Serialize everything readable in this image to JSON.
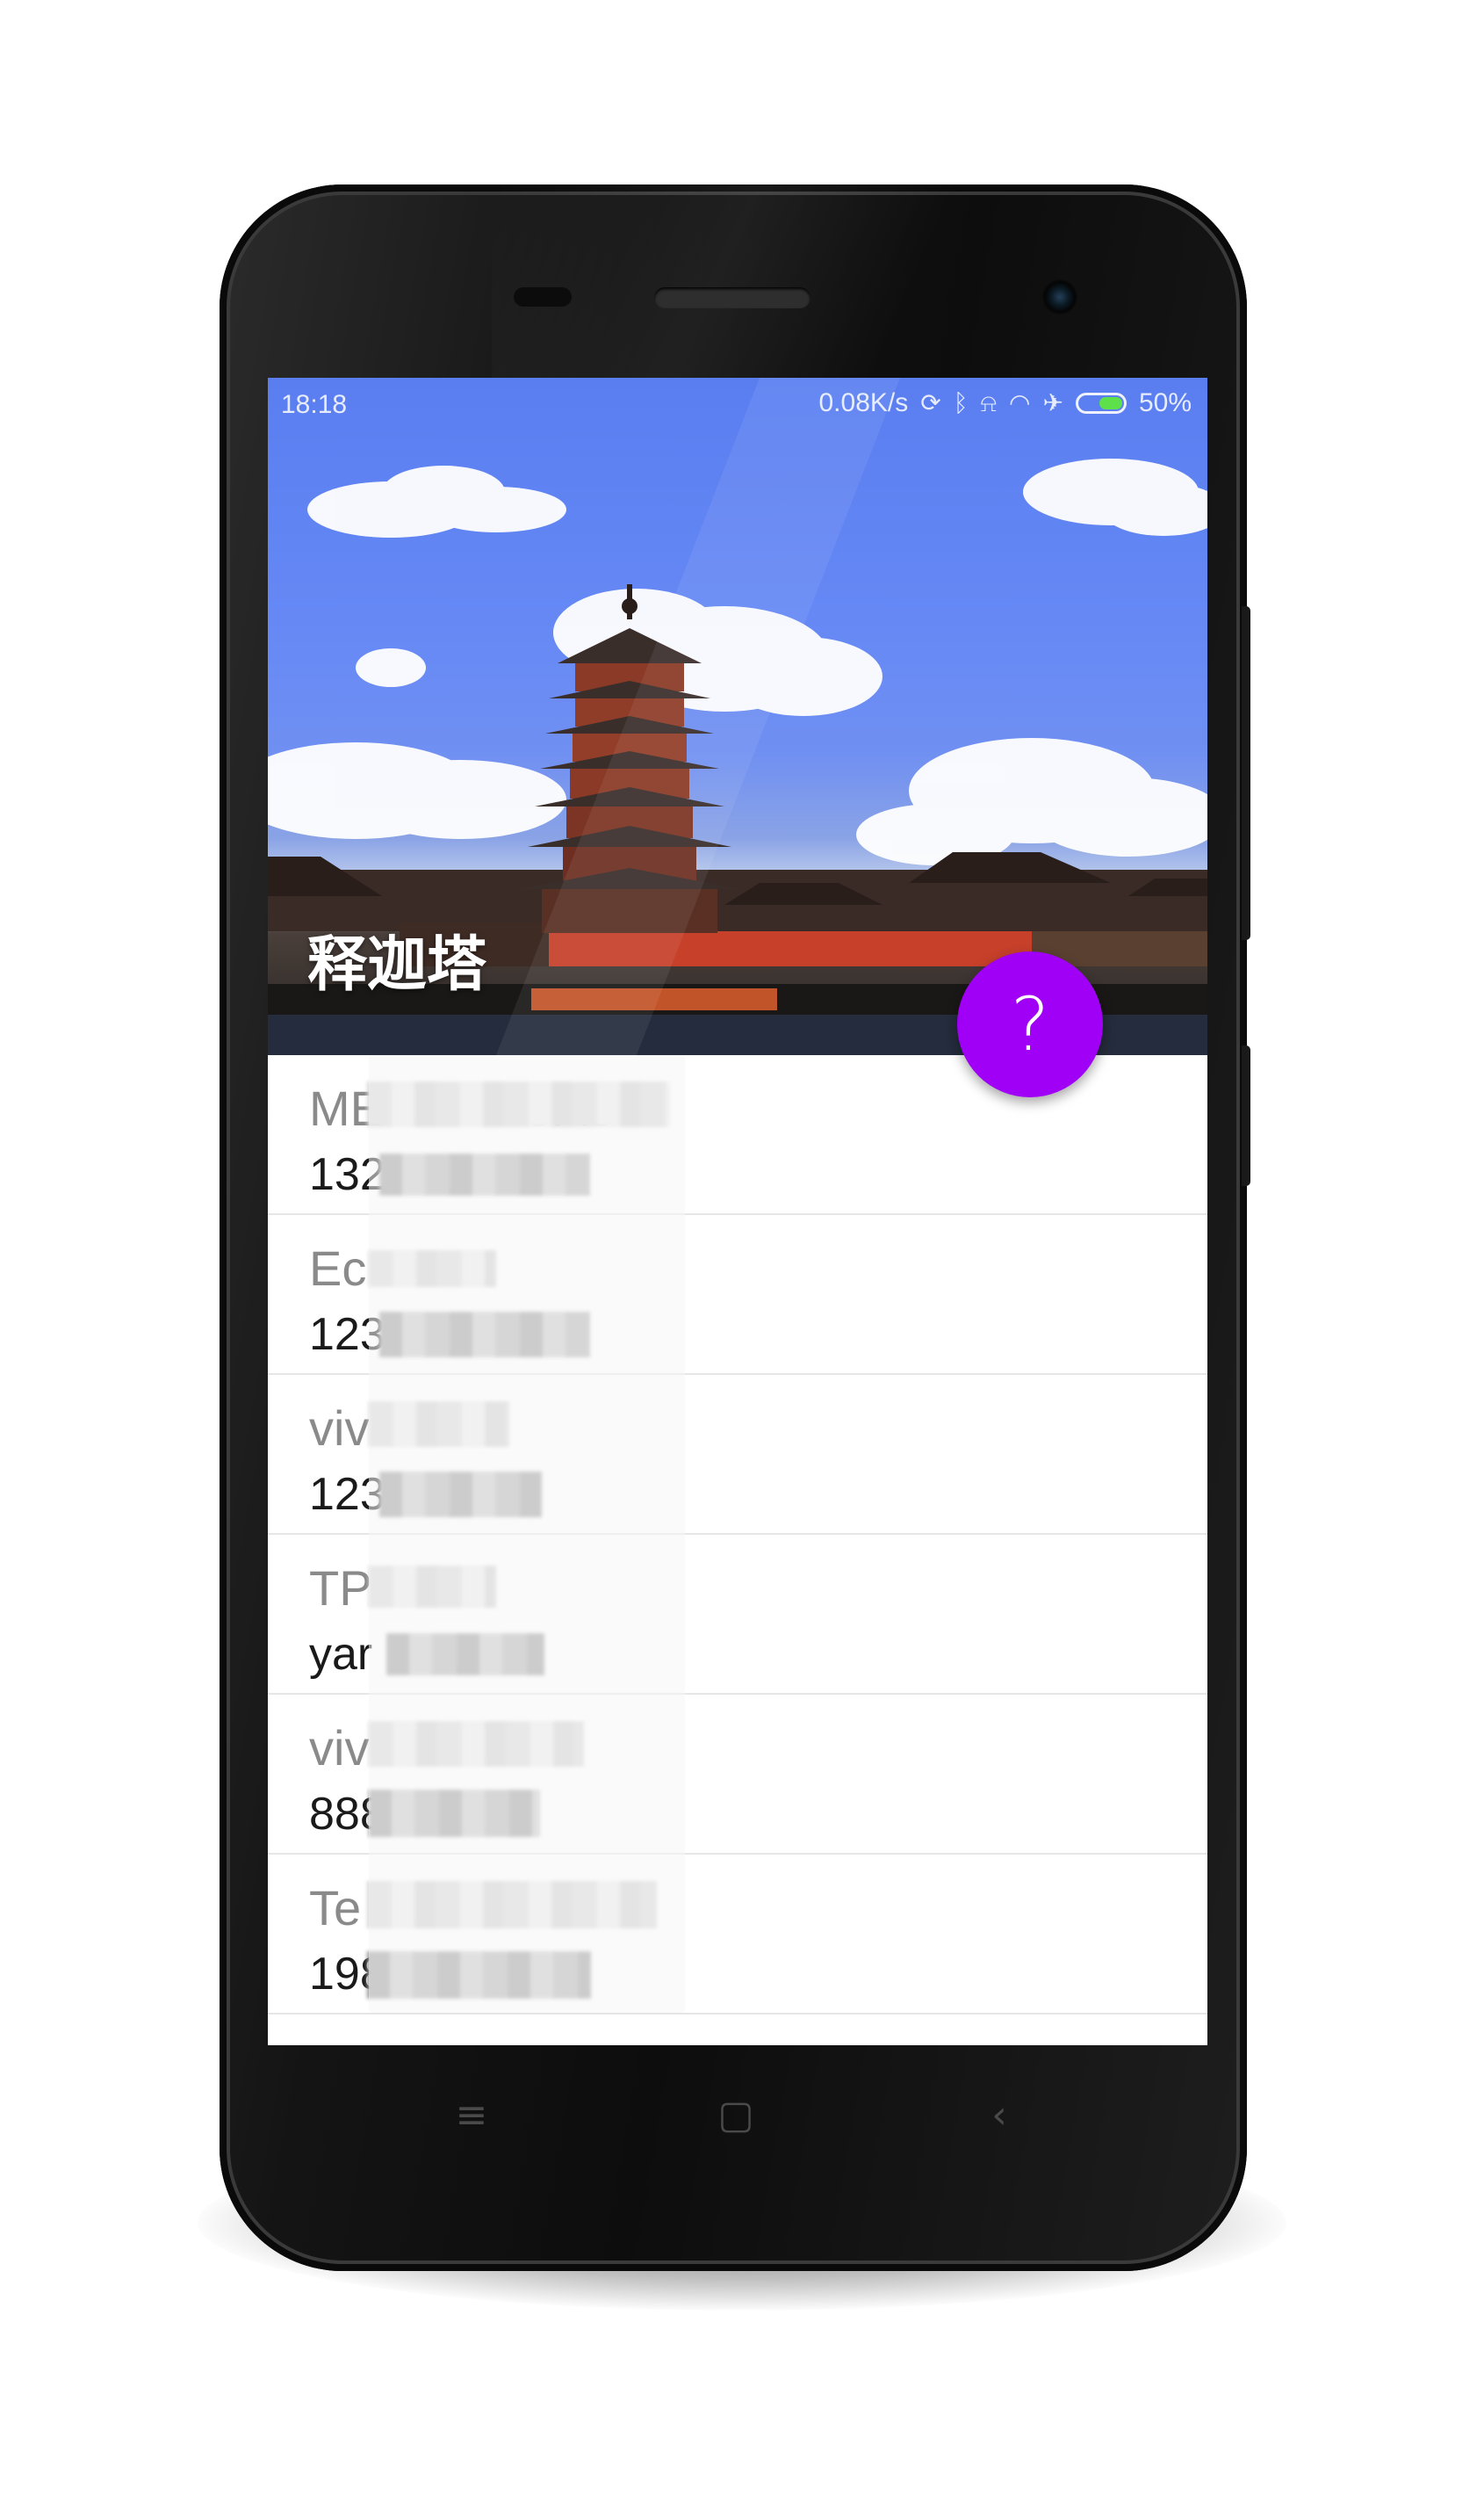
{
  "status_bar": {
    "time": "18:18",
    "network_speed": "0.08K/s",
    "battery_percent": "50%",
    "battery_level": 0.5,
    "icons": [
      "sync-icon",
      "bluetooth-icon",
      "alarm-off-icon",
      "wifi-icon",
      "airplane-icon",
      "battery-icon"
    ]
  },
  "header": {
    "title": "释迦塔",
    "image": "pagoda-landscape-photo"
  },
  "fab": {
    "label": "?",
    "color": "#a000f6"
  },
  "list": {
    "items": [
      {
        "name": "ME          CA8",
        "value": "132"
      },
      {
        "name": "Ec",
        "value": "123"
      },
      {
        "name": "viv",
        "value": "123"
      },
      {
        "name": "TP",
        "value": "yar"
      },
      {
        "name": "viv",
        "value": "888"
      },
      {
        "name": "Te",
        "value": "198"
      }
    ]
  },
  "nav_bar": {
    "icons": [
      "menu-icon",
      "home-icon",
      "back-icon"
    ]
  }
}
